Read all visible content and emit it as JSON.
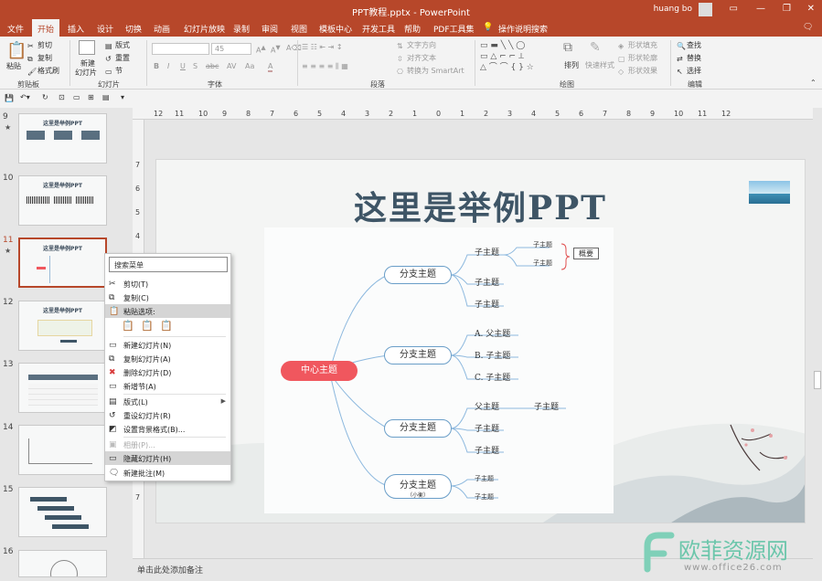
{
  "window": {
    "title": "PPT教程.pptx - PowerPoint",
    "user": "huang bo",
    "controls": [
      "—",
      "❐",
      "✕"
    ]
  },
  "tabs": [
    "文件",
    "开始",
    "插入",
    "设计",
    "切换",
    "动画",
    "幻灯片放映",
    "录制",
    "审阅",
    "视图",
    "模板中心",
    "开发工具",
    "帮助",
    "PDF工具集",
    "操作说明搜索"
  ],
  "ribbon": {
    "clipboard": {
      "paste": "粘贴",
      "cut": "剪切",
      "copy": "复制",
      "format_painter": "格式刷",
      "label": "剪贴板"
    },
    "slides": {
      "new_slide_1": "新建",
      "new_slide_2": "幻灯片",
      "layout": "版式",
      "reset": "重置",
      "section": "节",
      "label": "幻灯片"
    },
    "font": {
      "size": "45",
      "label": "字体"
    },
    "paragraph": {
      "text_direction": "文字方向",
      "align_text": "对齐文本",
      "smartart": "转换为 SmartArt",
      "label": "段落"
    },
    "drawing": {
      "arrange": "排列",
      "quick_styles": "快速样式",
      "fill": "形状填充",
      "outline": "形状轮廓",
      "effects": "形状效果",
      "label": "绘图"
    },
    "editing": {
      "find": "查找",
      "replace": "替换",
      "select": "选择",
      "label": "编辑"
    }
  },
  "hruler_ticks": [
    "12",
    "11",
    "10",
    "9",
    "8",
    "7",
    "6",
    "5",
    "4",
    "3",
    "2",
    "1",
    "0",
    "1",
    "2",
    "3",
    "4",
    "5",
    "6",
    "7",
    "8",
    "9",
    "10",
    "11",
    "12"
  ],
  "vruler_ticks": [
    "7",
    "6",
    "5",
    "4",
    "3",
    "2",
    "1",
    "0",
    "1",
    "2",
    "3",
    "4",
    "5",
    "6",
    "7"
  ],
  "thumbnails": [
    {
      "num": "9",
      "star": "★",
      "title": "这里是举例PPT"
    },
    {
      "num": "10",
      "star": "",
      "title": "这里是举例PPT"
    },
    {
      "num": "11",
      "star": "★",
      "title": "这里是举例PPT"
    },
    {
      "num": "12",
      "star": "",
      "title": "这里是举例PPT"
    },
    {
      "num": "13",
      "star": "",
      "title": ""
    },
    {
      "num": "14",
      "star": "",
      "title": ""
    },
    {
      "num": "15",
      "star": "",
      "title": ""
    },
    {
      "num": "16",
      "star": "",
      "title": ""
    }
  ],
  "slide": {
    "title": "这里是举例PPT",
    "center": "中心主题",
    "branch1": "分支主题",
    "b1_sub1": "子主题",
    "b1_sub1_a": "子主题",
    "b1_sub1_b": "子主题",
    "summary": "概要",
    "b1_sub2": "子主题",
    "b1_sub3": "子主题",
    "branch2": "分支主题",
    "b2_a": "A. 父主题",
    "b2_b": "B. 子主题",
    "b2_c": "C. 子主题",
    "branch3": "分支主题",
    "b3_parent": "父主题",
    "b3_child": "子主题",
    "b3_sub2": "子主题",
    "b3_sub3": "子主题",
    "branch4": "分支主题",
    "branch4_note": "（小衡）",
    "b4_sub1": "子主题",
    "b4_sub2": "子主题"
  },
  "notes_placeholder": "单击此处添加备注",
  "context_menu": {
    "search": "搜索菜单",
    "items": [
      {
        "label": "剪切(T)",
        "icon": "scissors-icon",
        "state": "normal"
      },
      {
        "label": "复制(C)",
        "icon": "copy-icon",
        "state": "normal"
      },
      {
        "label": "粘贴选项:",
        "icon": "paste-icon",
        "state": "highlight"
      },
      {
        "label": "新建幻灯片(N)",
        "icon": "new-slide-icon",
        "state": "normal"
      },
      {
        "label": "复制幻灯片(A)",
        "icon": "duplicate-slide-icon",
        "state": "normal"
      },
      {
        "label": "删除幻灯片(D)",
        "icon": "delete-slide-icon",
        "state": "normal"
      },
      {
        "label": "新增节(A)",
        "icon": "section-icon",
        "state": "normal"
      },
      {
        "label": "版式(L)",
        "icon": "layout-icon",
        "state": "submenu"
      },
      {
        "label": "重设幻灯片(R)",
        "icon": "reset-icon",
        "state": "normal"
      },
      {
        "label": "设置背景格式(B)...",
        "icon": "background-icon",
        "state": "normal"
      },
      {
        "label": "相册(P)...",
        "icon": "album-icon",
        "state": "disabled"
      },
      {
        "label": "隐藏幻灯片(H)",
        "icon": "hide-slide-icon",
        "state": "selected"
      },
      {
        "label": "新建批注(M)",
        "icon": "comment-icon",
        "state": "normal"
      }
    ]
  },
  "watermark": {
    "cn": "欧菲资源网",
    "url": "www.office26.com"
  },
  "colors": {
    "brand": "#b7472a",
    "center_node": "#f0575e",
    "branch_border": "#6a9ec8",
    "title": "#3e5566"
  }
}
